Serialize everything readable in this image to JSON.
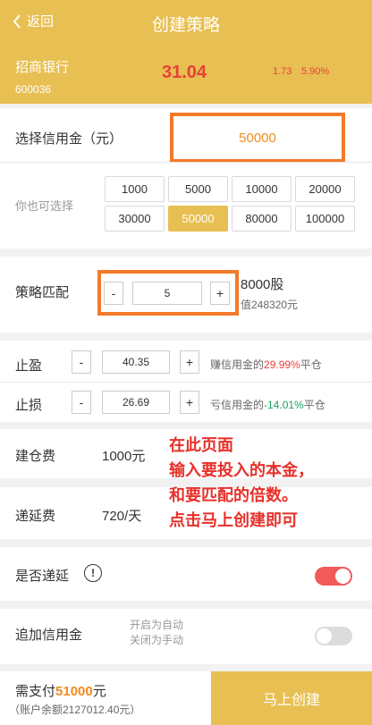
{
  "header": {
    "back_label": "返回",
    "title": "创建策略"
  },
  "stock": {
    "name": "招商银行",
    "code": "600036",
    "price": "31.04",
    "change": "1.73",
    "change_pct": "5.90%"
  },
  "credit": {
    "label": "选择信用金（元）",
    "value": "50000"
  },
  "options": {
    "label": "你也可选择",
    "items": [
      "1000",
      "5000",
      "10000",
      "20000",
      "30000",
      "50000",
      "80000",
      "100000"
    ],
    "selected": "50000"
  },
  "strategy": {
    "label": "策略匹配",
    "minus": "-",
    "plus": "+",
    "multiplier": "5",
    "shares": "8000股",
    "market_value": "值248320元"
  },
  "take_profit": {
    "label": "止盈",
    "minus": "-",
    "plus": "+",
    "value": "40.35",
    "note_prefix": "赚信用金的",
    "note_pct": "29.99%",
    "note_suffix": "平仓"
  },
  "stop_loss": {
    "label": "止损",
    "minus": "-",
    "plus": "+",
    "value": "26.69",
    "note_prefix": "亏信用金的",
    "note_pct": "-14.01%",
    "note_suffix": "平仓"
  },
  "fees": {
    "open_label": "建仓费",
    "open_value": "1000元",
    "defer_label": "递延费",
    "defer_value": "720/天"
  },
  "overlay_text": [
    "在此页面",
    "输入要投入的本金，",
    "和要匹配的倍数。",
    "点击马上创建即可"
  ],
  "defer": {
    "label": "是否递延",
    "info_icon": "!",
    "enabled": true
  },
  "add_credit": {
    "label": "追加信用金",
    "hint_on": "开启为自动",
    "hint_off": "关闭为手动",
    "enabled": false
  },
  "footer": {
    "pay_prefix": "需支付",
    "pay_amount": "51000",
    "pay_suffix": "元",
    "balance": "（账户余额2127012.40元）",
    "create_label": "马上创建"
  },
  "colors": {
    "accent": "#e8bf52",
    "red": "#e8413a",
    "highlight": "#f47a29",
    "toggle_on": "#f05a5a",
    "toggle_off": "#dcdcdc"
  }
}
